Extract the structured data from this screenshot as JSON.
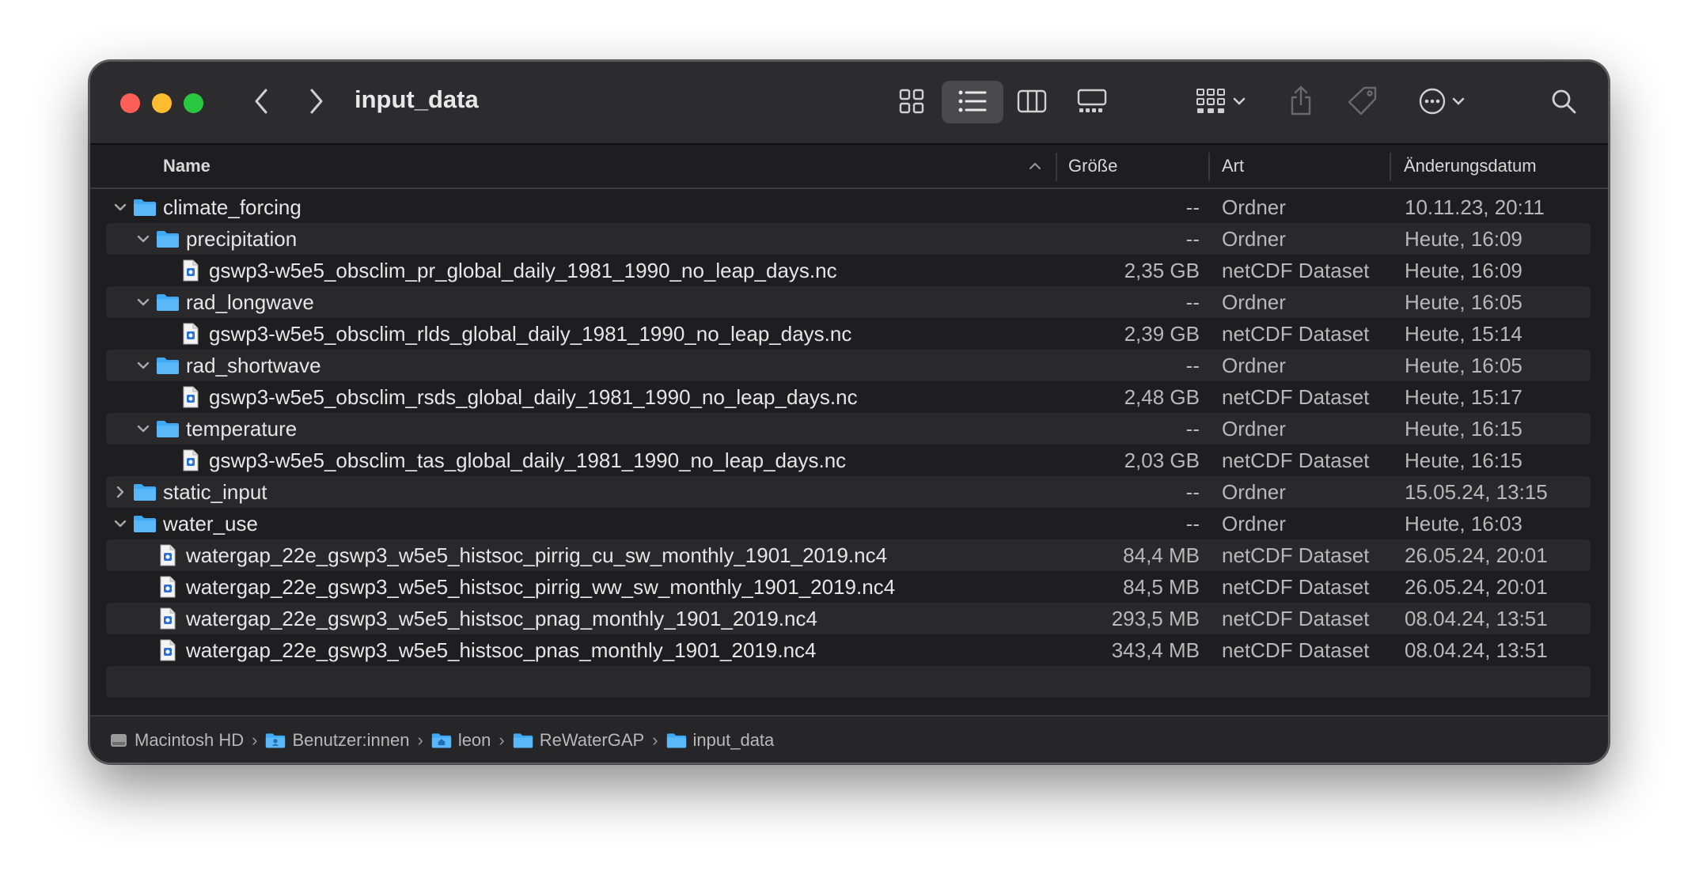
{
  "window": {
    "title": "input_data"
  },
  "toolbar": {
    "back": "back",
    "forward": "forward",
    "views": [
      "icon-view",
      "list-view",
      "column-view",
      "gallery-view"
    ],
    "active_view": "list-view"
  },
  "header": {
    "name": "Name",
    "size": "Größe",
    "kind": "Art",
    "date": "Änderungsdatum"
  },
  "rows": [
    {
      "name": "climate_forcing",
      "type": "folder",
      "level": 0,
      "disclosure": "open",
      "size": "--",
      "kind": "Ordner",
      "date": "10.11.23, 20:11"
    },
    {
      "name": "precipitation",
      "type": "folder",
      "level": 1,
      "disclosure": "open",
      "size": "--",
      "kind": "Ordner",
      "date": "Heute, 16:09"
    },
    {
      "name": "gswp3-w5e5_obsclim_pr_global_daily_1981_1990_no_leap_days.nc",
      "type": "file",
      "level": 2,
      "disclosure": "none",
      "size": "2,35 GB",
      "kind": "netCDF Dataset",
      "date": "Heute, 16:09"
    },
    {
      "name": "rad_longwave",
      "type": "folder",
      "level": 1,
      "disclosure": "open",
      "size": "--",
      "kind": "Ordner",
      "date": "Heute, 16:05"
    },
    {
      "name": "gswp3-w5e5_obsclim_rlds_global_daily_1981_1990_no_leap_days.nc",
      "type": "file",
      "level": 2,
      "disclosure": "none",
      "size": "2,39 GB",
      "kind": "netCDF Dataset",
      "date": "Heute, 15:14"
    },
    {
      "name": "rad_shortwave",
      "type": "folder",
      "level": 1,
      "disclosure": "open",
      "size": "--",
      "kind": "Ordner",
      "date": "Heute, 16:05"
    },
    {
      "name": "gswp3-w5e5_obsclim_rsds_global_daily_1981_1990_no_leap_days.nc",
      "type": "file",
      "level": 2,
      "disclosure": "none",
      "size": "2,48 GB",
      "kind": "netCDF Dataset",
      "date": "Heute, 15:17"
    },
    {
      "name": "temperature",
      "type": "folder",
      "level": 1,
      "disclosure": "open",
      "size": "--",
      "kind": "Ordner",
      "date": "Heute, 16:15"
    },
    {
      "name": "gswp3-w5e5_obsclim_tas_global_daily_1981_1990_no_leap_days.nc",
      "type": "file",
      "level": 2,
      "disclosure": "none",
      "size": "2,03 GB",
      "kind": "netCDF Dataset",
      "date": "Heute, 16:15"
    },
    {
      "name": "static_input",
      "type": "folder",
      "level": 0,
      "disclosure": "closed",
      "size": "--",
      "kind": "Ordner",
      "date": "15.05.24, 13:15"
    },
    {
      "name": "water_use",
      "type": "folder",
      "level": 0,
      "disclosure": "open",
      "size": "--",
      "kind": "Ordner",
      "date": "Heute, 16:03"
    },
    {
      "name": "watergap_22e_gswp3_w5e5_histsoc_pirrig_cu_sw_monthly_1901_2019.nc4",
      "type": "file",
      "level": 1,
      "disclosure": "none",
      "size": "84,4 MB",
      "kind": "netCDF Dataset",
      "date": "26.05.24, 20:01"
    },
    {
      "name": "watergap_22e_gswp3_w5e5_histsoc_pirrig_ww_sw_monthly_1901_2019.nc4",
      "type": "file",
      "level": 1,
      "disclosure": "none",
      "size": "84,5 MB",
      "kind": "netCDF Dataset",
      "date": "26.05.24, 20:01"
    },
    {
      "name": "watergap_22e_gswp3_w5e5_histsoc_pnag_monthly_1901_2019.nc4",
      "type": "file",
      "level": 1,
      "disclosure": "none",
      "size": "293,5 MB",
      "kind": "netCDF Dataset",
      "date": "08.04.24, 13:51"
    },
    {
      "name": "watergap_22e_gswp3_w5e5_histsoc_pnas_monthly_1901_2019.nc4",
      "type": "file",
      "level": 1,
      "disclosure": "none",
      "size": "343,4 MB",
      "kind": "netCDF Dataset",
      "date": "08.04.24, 13:51"
    }
  ],
  "pathbar": [
    {
      "label": "Macintosh HD",
      "icon": "disk-icon"
    },
    {
      "label": "Benutzer:innen",
      "icon": "users-folder-icon"
    },
    {
      "label": "leon",
      "icon": "home-folder-icon"
    },
    {
      "label": "ReWaterGAP",
      "icon": "folder-icon"
    },
    {
      "label": "input_data",
      "icon": "folder-icon"
    }
  ],
  "colors": {
    "folder": "#3fa9f5",
    "accent": "#0a84ff"
  }
}
